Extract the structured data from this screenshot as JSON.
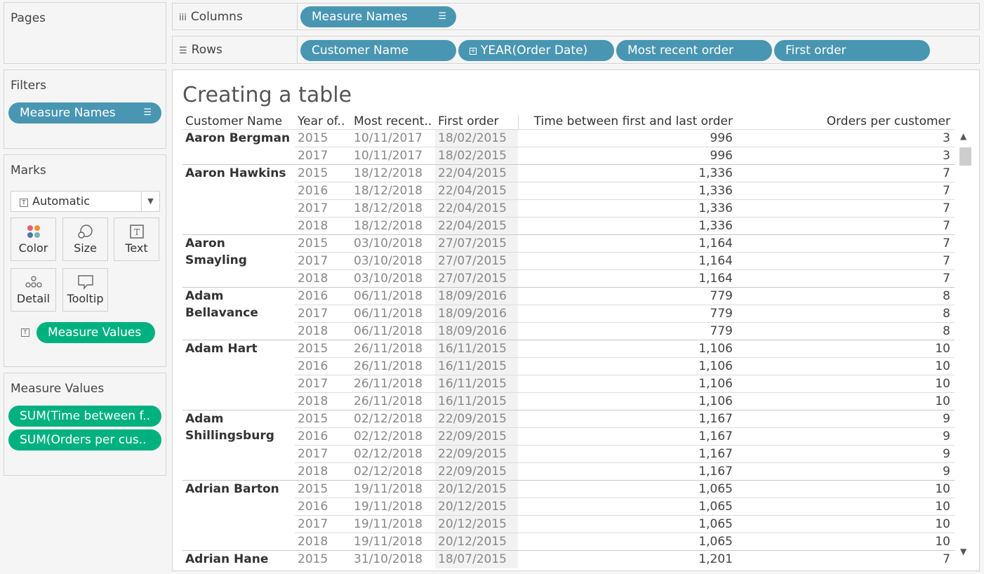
{
  "pages": {
    "title": "Pages"
  },
  "filters": {
    "title": "Filters",
    "pill": "Measure Names"
  },
  "marks": {
    "title": "Marks",
    "type_dropdown": "Automatic",
    "buttons": {
      "color": "Color",
      "size": "Size",
      "text": "Text",
      "detail": "Detail",
      "tooltip": "Tooltip"
    },
    "text_pill": "Measure Values"
  },
  "measure_values": {
    "title": "Measure Values",
    "pills": [
      "SUM(Time between f..",
      "SUM(Orders per cus.."
    ]
  },
  "columns_shelf": {
    "label": "Columns",
    "pills": [
      "Measure Names"
    ]
  },
  "rows_shelf": {
    "label": "Rows",
    "pills": [
      "Customer Name",
      "YEAR(Order Date)",
      "Most recent order",
      "First order"
    ]
  },
  "view": {
    "title": "Creating a table",
    "headers": [
      "Customer Name",
      "Year of..",
      "Most recent..",
      "First order",
      "Time between first and last order",
      "Orders per customer"
    ],
    "groups": [
      {
        "name": "Aaron Bergman",
        "rows": [
          [
            "2015",
            "10/11/2017",
            "18/02/2015",
            "996",
            "3"
          ],
          [
            "2017",
            "10/11/2017",
            "18/02/2015",
            "996",
            "3"
          ]
        ]
      },
      {
        "name": "Aaron Hawkins",
        "rows": [
          [
            "2015",
            "18/12/2018",
            "22/04/2015",
            "1,336",
            "7"
          ],
          [
            "2016",
            "18/12/2018",
            "22/04/2015",
            "1,336",
            "7"
          ],
          [
            "2017",
            "18/12/2018",
            "22/04/2015",
            "1,336",
            "7"
          ],
          [
            "2018",
            "18/12/2018",
            "22/04/2015",
            "1,336",
            "7"
          ]
        ]
      },
      {
        "name": "Aaron Smayling",
        "rows": [
          [
            "2015",
            "03/10/2018",
            "27/07/2015",
            "1,164",
            "7"
          ],
          [
            "2017",
            "03/10/2018",
            "27/07/2015",
            "1,164",
            "7"
          ],
          [
            "2018",
            "03/10/2018",
            "27/07/2015",
            "1,164",
            "7"
          ]
        ]
      },
      {
        "name": "Adam Bellavance",
        "rows": [
          [
            "2016",
            "06/11/2018",
            "18/09/2016",
            "779",
            "8"
          ],
          [
            "2017",
            "06/11/2018",
            "18/09/2016",
            "779",
            "8"
          ],
          [
            "2018",
            "06/11/2018",
            "18/09/2016",
            "779",
            "8"
          ]
        ]
      },
      {
        "name": "Adam Hart",
        "rows": [
          [
            "2015",
            "26/11/2018",
            "16/11/2015",
            "1,106",
            "10"
          ],
          [
            "2016",
            "26/11/2018",
            "16/11/2015",
            "1,106",
            "10"
          ],
          [
            "2017",
            "26/11/2018",
            "16/11/2015",
            "1,106",
            "10"
          ],
          [
            "2018",
            "26/11/2018",
            "16/11/2015",
            "1,106",
            "10"
          ]
        ]
      },
      {
        "name": "Adam Shillingsburg",
        "rows": [
          [
            "2015",
            "02/12/2018",
            "22/09/2015",
            "1,167",
            "9"
          ],
          [
            "2016",
            "02/12/2018",
            "22/09/2015",
            "1,167",
            "9"
          ],
          [
            "2017",
            "02/12/2018",
            "22/09/2015",
            "1,167",
            "9"
          ],
          [
            "2018",
            "02/12/2018",
            "22/09/2015",
            "1,167",
            "9"
          ]
        ]
      },
      {
        "name": "Adrian Barton",
        "rows": [
          [
            "2015",
            "19/11/2018",
            "20/12/2015",
            "1,065",
            "10"
          ],
          [
            "2016",
            "19/11/2018",
            "20/12/2015",
            "1,065",
            "10"
          ],
          [
            "2017",
            "19/11/2018",
            "20/12/2015",
            "1,065",
            "10"
          ],
          [
            "2018",
            "19/11/2018",
            "20/12/2015",
            "1,065",
            "10"
          ]
        ]
      },
      {
        "name": "Adrian Hane",
        "rows": [
          [
            "2015",
            "31/10/2018",
            "18/07/2015",
            "1,201",
            "7"
          ]
        ]
      }
    ]
  },
  "icons": {
    "columns": "columns-icon",
    "rows": "rows-icon",
    "sort": "sort-icon",
    "expand": "expand-plus-icon",
    "dropdown": "chevron-down-icon",
    "color": "color-dots-icon",
    "size": "size-circles-icon",
    "text": "text-box-icon",
    "detail": "detail-dots-icon",
    "tooltip": "tooltip-bubble-icon"
  },
  "colors": {
    "dimension_pill": "#4996b2",
    "measure_pill": "#00b180"
  }
}
